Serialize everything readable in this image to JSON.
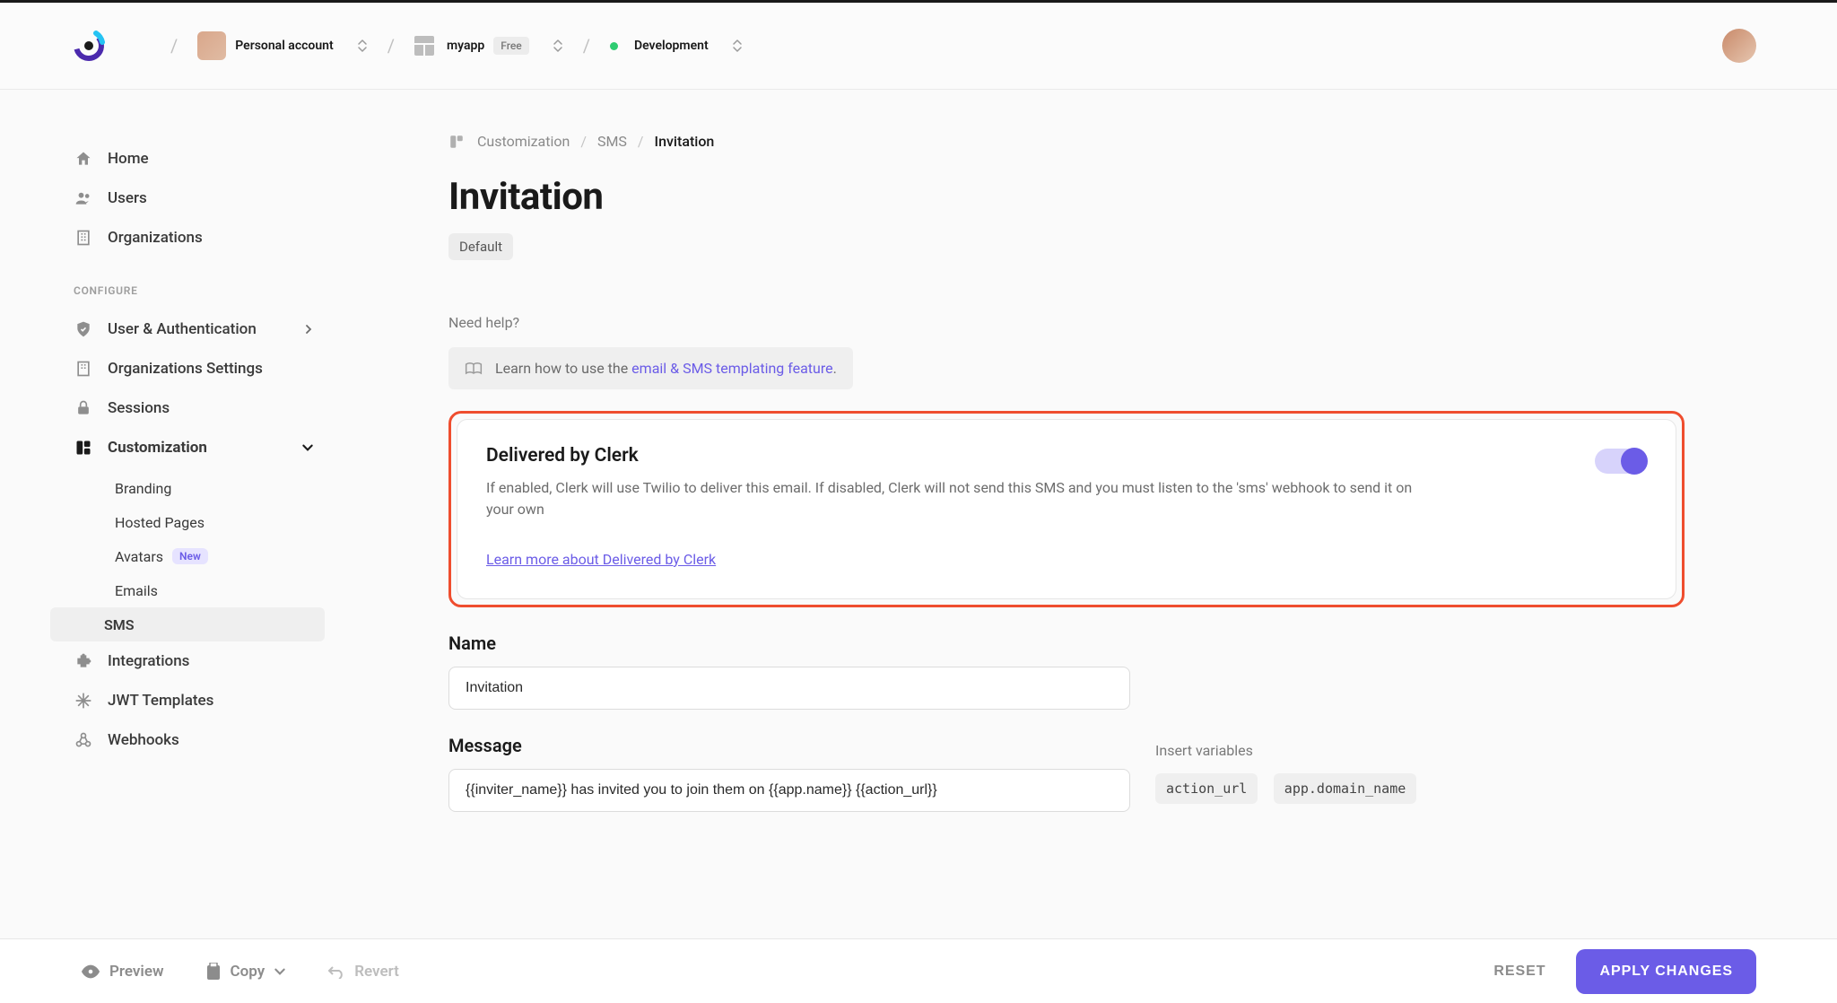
{
  "topbar": {
    "account_label": "Personal account",
    "app_name": "myapp",
    "app_plan": "Free",
    "env_label": "Development"
  },
  "sidebar": {
    "items_top": [
      {
        "key": "home",
        "label": "Home"
      },
      {
        "key": "users",
        "label": "Users"
      },
      {
        "key": "organizations",
        "label": "Organizations"
      }
    ],
    "section_label": "CONFIGURE",
    "items_config": [
      {
        "key": "user-auth",
        "label": "User & Authentication",
        "chevron": "right"
      },
      {
        "key": "org-settings",
        "label": "Organizations Settings"
      },
      {
        "key": "sessions",
        "label": "Sessions"
      },
      {
        "key": "customization",
        "label": "Customization",
        "chevron": "down",
        "selected": true
      },
      {
        "key": "integrations",
        "label": "Integrations"
      },
      {
        "key": "jwt",
        "label": "JWT Templates"
      },
      {
        "key": "webhooks",
        "label": "Webhooks"
      }
    ],
    "customization_sub": [
      {
        "key": "branding",
        "label": "Branding"
      },
      {
        "key": "hosted-pages",
        "label": "Hosted Pages"
      },
      {
        "key": "avatars",
        "label": "Avatars",
        "badge": "New"
      },
      {
        "key": "emails",
        "label": "Emails"
      },
      {
        "key": "sms",
        "label": "SMS",
        "active": true
      }
    ]
  },
  "breadcrumb": {
    "a": "Customization",
    "b": "SMS",
    "c": "Invitation"
  },
  "page": {
    "title": "Invitation",
    "tag": "Default",
    "need_help": "Need help?",
    "help_prefix": "Learn how to use the ",
    "help_link": "email & SMS templating feature",
    "help_suffix": "."
  },
  "delivered_card": {
    "title": "Delivered by Clerk",
    "desc": "If enabled, Clerk will use Twilio to deliver this email. If disabled, Clerk will not send this SMS and you must listen to the 'sms' webhook to send it on your own",
    "link": "Learn more about Delivered by Clerk",
    "enabled": true
  },
  "form": {
    "name_label": "Name",
    "name_value": "Invitation",
    "message_label": "Message",
    "message_value": "{{inviter_name}} has invited you to join them on {{app.name}} {{action_url}}",
    "vars_label": "Insert variables",
    "vars": [
      "action_url",
      "app.domain_name"
    ]
  },
  "footer": {
    "preview": "Preview",
    "copy": "Copy",
    "revert": "Revert",
    "reset": "RESET",
    "apply": "APPLY CHANGES"
  }
}
